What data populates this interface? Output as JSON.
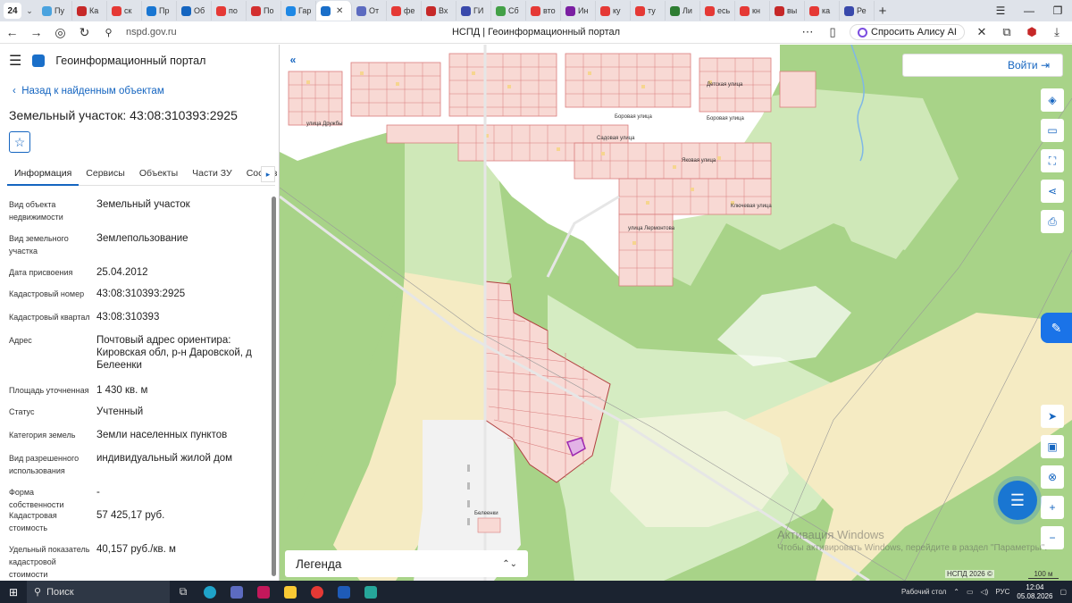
{
  "browser": {
    "tab_counter": "24",
    "tabs": [
      {
        "label": "Пу",
        "color": "#4aa3df"
      },
      {
        "label": "Ка",
        "color": "#c62828"
      },
      {
        "label": "ск",
        "color": "#e53935"
      },
      {
        "label": "Пр",
        "color": "#1976d2"
      },
      {
        "label": "Об",
        "color": "#1565c0"
      },
      {
        "label": "по",
        "color": "#e53935"
      },
      {
        "label": "По",
        "color": "#d32f2f"
      },
      {
        "label": "Гар",
        "color": "#1e88e5"
      },
      {
        "label": "",
        "color": "#1a6fc9",
        "active": true
      },
      {
        "label": "От",
        "color": "#5c6bc0"
      },
      {
        "label": "фе",
        "color": "#e53935"
      },
      {
        "label": "Вх",
        "color": "#c62828"
      },
      {
        "label": "ГИ",
        "color": "#3949ab"
      },
      {
        "label": "Сб",
        "color": "#43a047"
      },
      {
        "label": "вто",
        "color": "#e53935"
      },
      {
        "label": "Ин",
        "color": "#7b1fa2"
      },
      {
        "label": "ку",
        "color": "#e53935"
      },
      {
        "label": "ту",
        "color": "#e53935"
      },
      {
        "label": "Ли",
        "color": "#2e7d32"
      },
      {
        "label": "есь",
        "color": "#e53935"
      },
      {
        "label": "кн",
        "color": "#e53935"
      },
      {
        "label": "вы",
        "color": "#c62828"
      },
      {
        "label": "ка",
        "color": "#e53935"
      },
      {
        "label": "Ре",
        "color": "#3949ab"
      }
    ],
    "url": "nspd.gov.ru",
    "page_title": "НСПД | Геоинформационный портал",
    "alice_label": "Спросить Алису AI"
  },
  "sidebar": {
    "portal_name": "Геоинформационный портал",
    "back_link": "Назад к найденным объектам",
    "title": "Земельный участок: 43:08:310393:2925",
    "tabs": [
      "Информация",
      "Сервисы",
      "Объекты",
      "Части ЗУ",
      "Состав"
    ],
    "properties": [
      {
        "key": "Вид объекта недвижимости",
        "value": "Земельный участок"
      },
      {
        "key": "Вид земельного участка",
        "value": "Землепользование"
      },
      {
        "key": "Дата присвоения",
        "value": "25.04.2012"
      },
      {
        "key": "Кадастровый номер",
        "value": "43:08:310393:2925"
      },
      {
        "key": "Кадастровый квартал",
        "value": "43:08:310393"
      },
      {
        "key": "Адрес",
        "value": "Почтовый адрес ориентира: Кировская обл, р-н Даровской, д Белеенки"
      },
      {
        "key": "Площадь уточненная",
        "value": "1 430 кв. м"
      },
      {
        "key": "Статус",
        "value": "Учтенный"
      },
      {
        "key": "Категория земель",
        "value": "Земли населенных пунктов"
      },
      {
        "key": "Вид разрешенного использования",
        "value": "индивидуальный жилой дом"
      },
      {
        "key": "Форма собственности",
        "value": "-"
      },
      {
        "key": "Кадастровая стоимость",
        "value": "57 425,17 руб."
      },
      {
        "key": "Удельный показатель кадастровой стоимости",
        "value": "40,157 руб./кв. м"
      }
    ]
  },
  "map": {
    "login_label": "Войти",
    "legend_label": "Легенда",
    "watermark_line1": "Активация Windows",
    "watermark_line2": "Чтобы активировать Windows, перейдите в раздел \"Параметры\".",
    "copyright": "НСПД 2026 ©",
    "scale": "100 м",
    "streets": [
      "Детская улица",
      "Боровая улица",
      "Боровая улица",
      "Садовая улица",
      "Яковая улица",
      "Ключевая улица",
      "улица Лермонтова",
      "улица Дружбы",
      "Белеенки"
    ]
  },
  "taskbar": {
    "search_label": "Поиск",
    "desktop_label": "Рабочий стол",
    "lang": "РУС",
    "time": "12:04",
    "date": "05.08.2026"
  }
}
